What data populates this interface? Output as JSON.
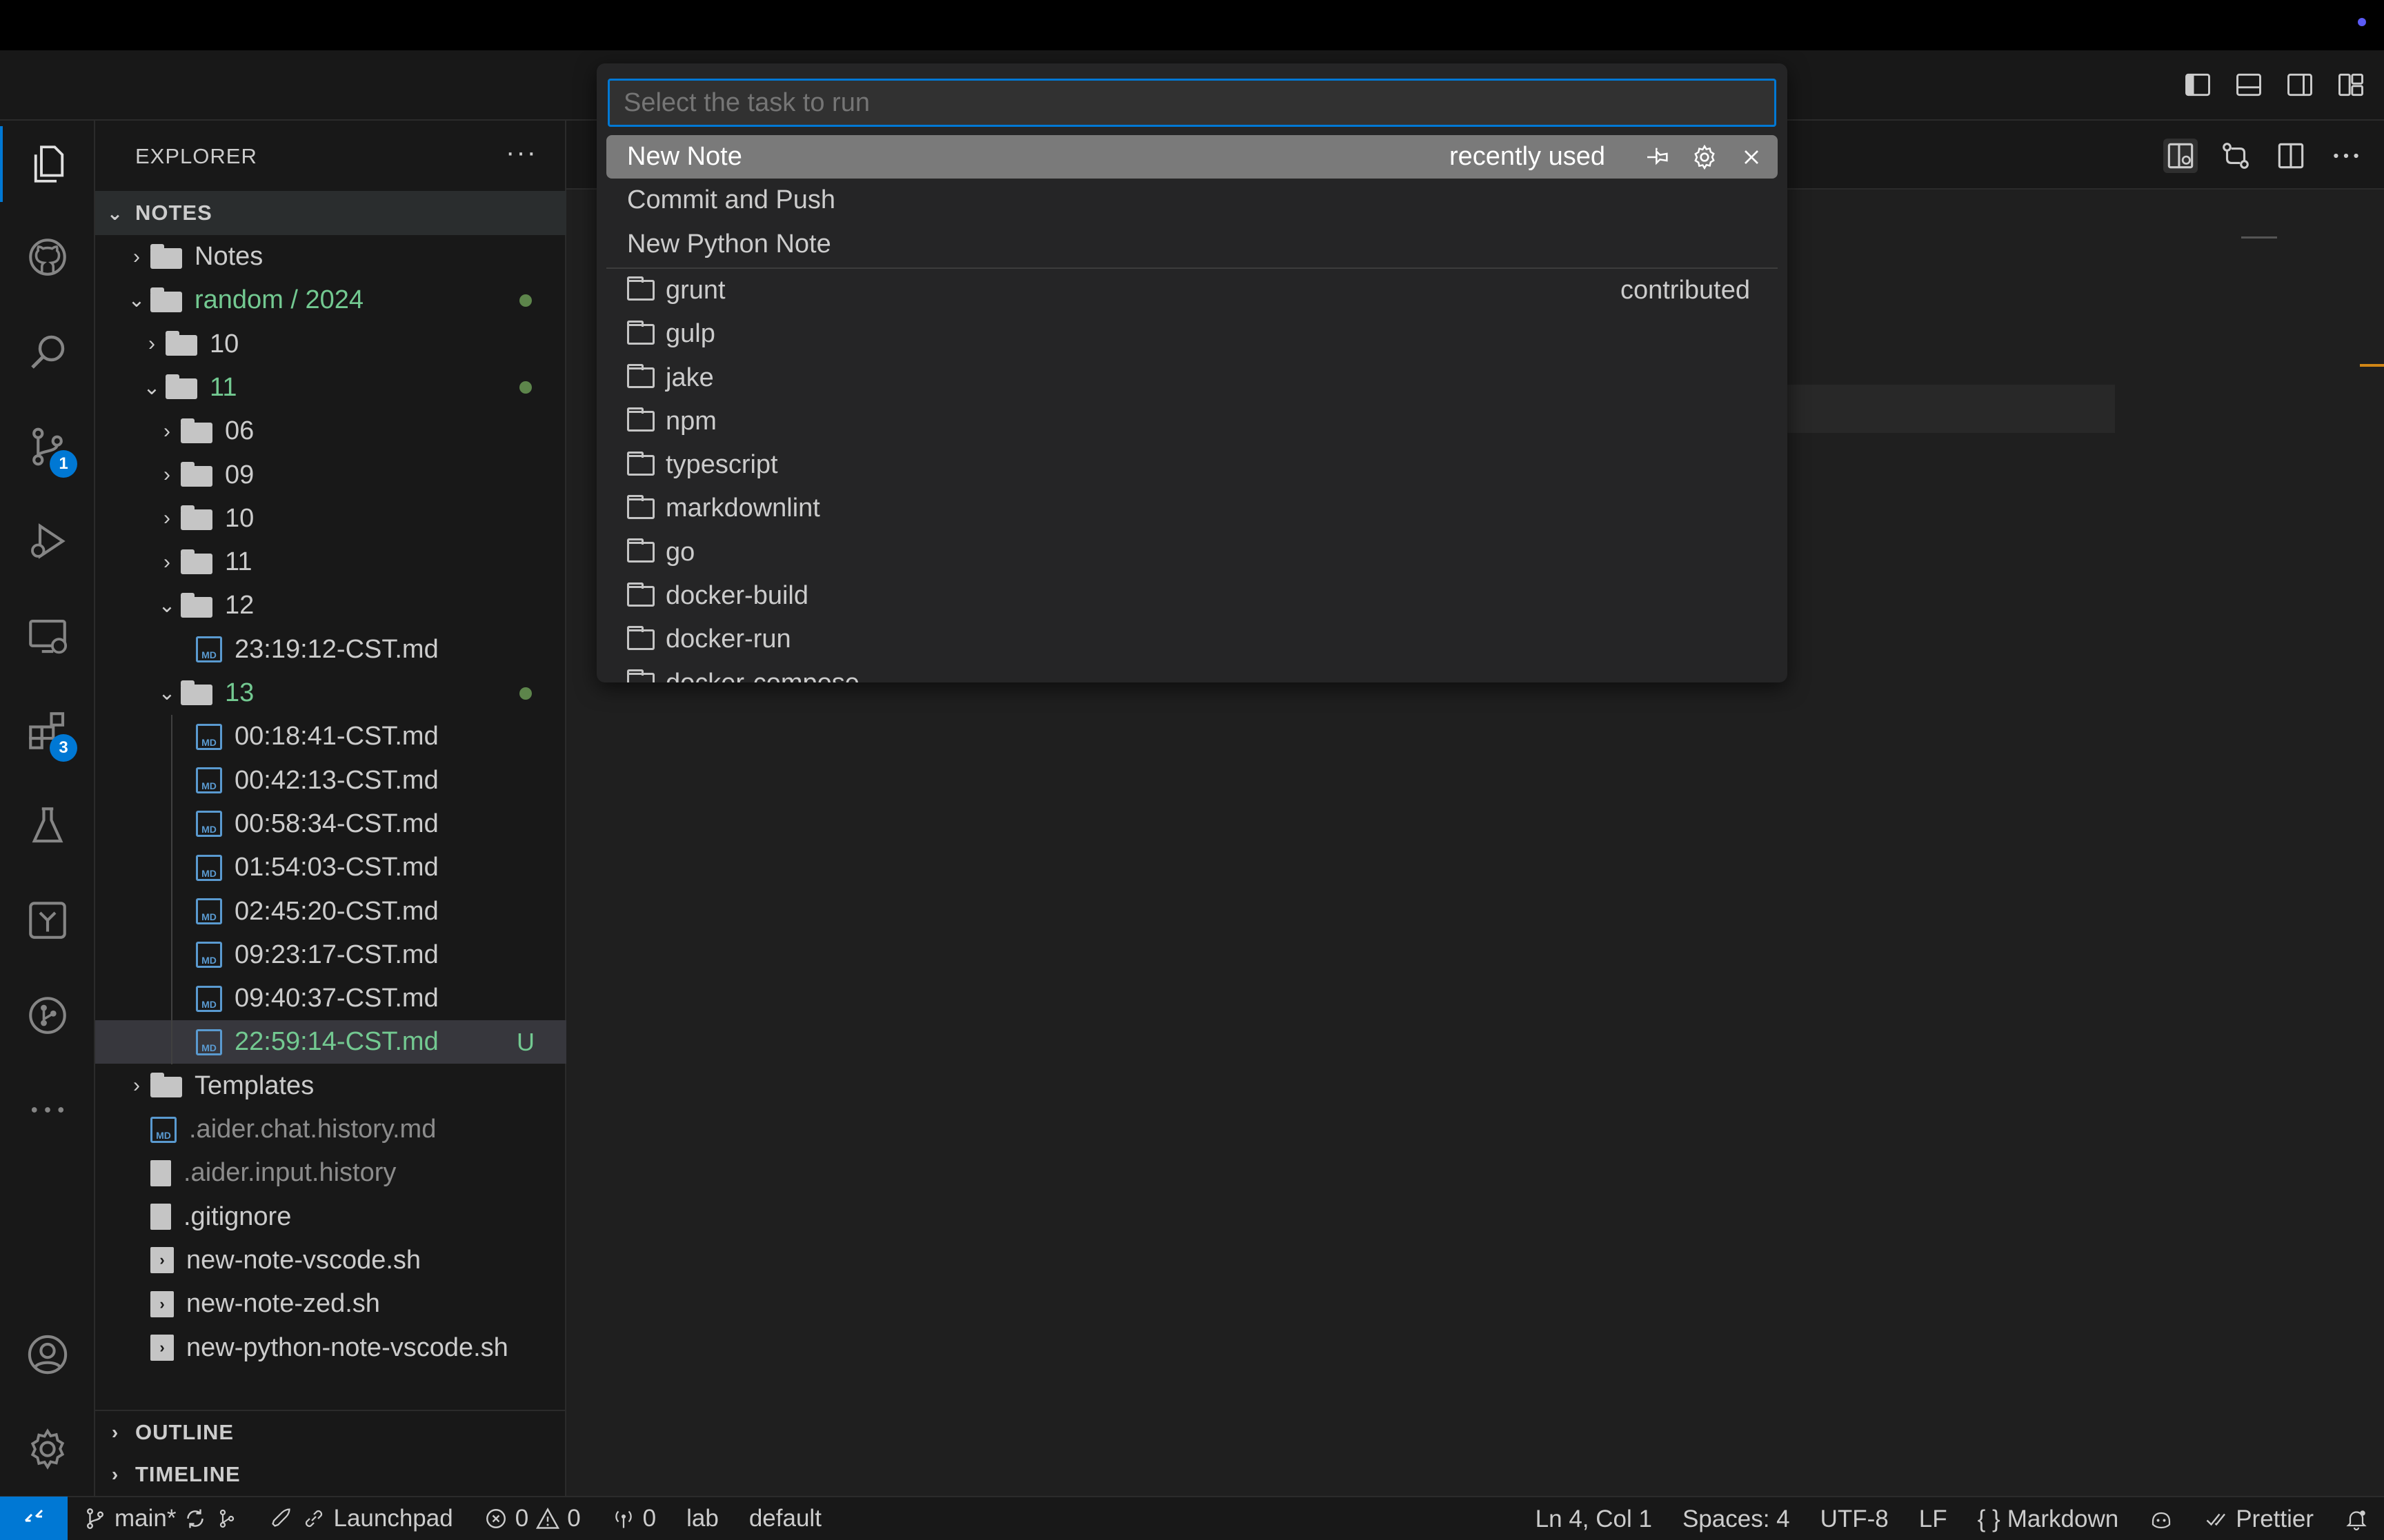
{
  "explorer": {
    "title": "EXPLORER",
    "more": "···",
    "sections": {
      "notes": "NOTES",
      "outline": "OUTLINE",
      "timeline": "TIMELINE"
    },
    "tree": [
      {
        "label": "Notes",
        "type": "folder",
        "depth": 0,
        "expanded": false
      },
      {
        "label": "random / 2024",
        "type": "folder",
        "depth": 0,
        "expanded": true,
        "modified": true
      },
      {
        "label": "10",
        "type": "folder",
        "depth": 1,
        "expanded": false
      },
      {
        "label": "11",
        "type": "folder",
        "depth": 1,
        "expanded": true,
        "modified": true
      },
      {
        "label": "06",
        "type": "folder",
        "depth": 2,
        "expanded": false
      },
      {
        "label": "09",
        "type": "folder",
        "depth": 2,
        "expanded": false
      },
      {
        "label": "10",
        "type": "folder",
        "depth": 2,
        "expanded": false
      },
      {
        "label": "11",
        "type": "folder",
        "depth": 2,
        "expanded": false
      },
      {
        "label": "12",
        "type": "folder",
        "depth": 2,
        "expanded": true
      },
      {
        "label": "23:19:12-CST.md",
        "type": "md",
        "depth": 3
      },
      {
        "label": "13",
        "type": "folder",
        "depth": 2,
        "expanded": true,
        "modified": true
      },
      {
        "label": "00:18:41-CST.md",
        "type": "md",
        "depth": 3
      },
      {
        "label": "00:42:13-CST.md",
        "type": "md",
        "depth": 3
      },
      {
        "label": "00:58:34-CST.md",
        "type": "md",
        "depth": 3
      },
      {
        "label": "01:54:03-CST.md",
        "type": "md",
        "depth": 3
      },
      {
        "label": "02:45:20-CST.md",
        "type": "md",
        "depth": 3
      },
      {
        "label": "09:23:17-CST.md",
        "type": "md",
        "depth": 3
      },
      {
        "label": "09:40:37-CST.md",
        "type": "md",
        "depth": 3
      },
      {
        "label": "22:59:14-CST.md",
        "type": "md",
        "depth": 3,
        "untracked": "U",
        "selected": true
      },
      {
        "label": "Templates",
        "type": "folder",
        "depth": 0,
        "expanded": false
      },
      {
        "label": ".aider.chat.history.md",
        "type": "md",
        "depth": 0,
        "ignored": true
      },
      {
        "label": ".aider.input.history",
        "type": "file",
        "depth": 0,
        "ignored": true
      },
      {
        "label": ".gitignore",
        "type": "file",
        "depth": 0
      },
      {
        "label": "new-note-vscode.sh",
        "type": "sh",
        "depth": 0
      },
      {
        "label": "new-note-zed.sh",
        "type": "sh",
        "depth": 0
      },
      {
        "label": "new-python-note-vscode.sh",
        "type": "sh",
        "depth": 0
      }
    ]
  },
  "activity_bar": {
    "items": [
      "explorer-icon",
      "github-icon",
      "search-icon",
      "source-control-icon",
      "run-debug-icon",
      "remote-explorer-icon",
      "extensions-icon",
      "testing-icon",
      "terraform-icon",
      "git-graph-icon",
      "more-icon"
    ],
    "badges": {
      "source_control": "1",
      "extensions": "3"
    },
    "bottom": [
      "account-icon",
      "settings-gear-icon"
    ]
  },
  "quick_pick": {
    "placeholder": "Select the task to run",
    "items": [
      {
        "label": "New Note",
        "description": "recently used",
        "focused": true
      },
      {
        "label": "Commit and Push"
      },
      {
        "label": "New Python Note"
      },
      {
        "label": "grunt",
        "description": "contributed",
        "folder": true
      },
      {
        "label": "gulp",
        "folder": true
      },
      {
        "label": "jake",
        "folder": true
      },
      {
        "label": "npm",
        "folder": true
      },
      {
        "label": "typescript",
        "folder": true
      },
      {
        "label": "markdownlint",
        "folder": true
      },
      {
        "label": "go",
        "folder": true
      },
      {
        "label": "docker-build",
        "folder": true
      },
      {
        "label": "docker-run",
        "folder": true
      },
      {
        "label": "docker-compose",
        "folder": true
      }
    ],
    "actions": [
      "pin-icon",
      "gear-icon",
      "close-icon"
    ]
  },
  "status_bar": {
    "branch": "main*",
    "launchpad": "Launchpad",
    "errors": "0",
    "warnings": "0",
    "ports": "0",
    "lab": "lab",
    "profile": "default",
    "cursor": "Ln 4, Col 1",
    "spaces": "Spaces: 4",
    "encoding": "UTF-8",
    "eol": "LF",
    "language": "Markdown",
    "prettier": "Prettier"
  },
  "colors": {
    "accent": "#0078d4",
    "git_added": "#73c991",
    "background": "#1f1f1f",
    "sidebar": "#181818"
  }
}
